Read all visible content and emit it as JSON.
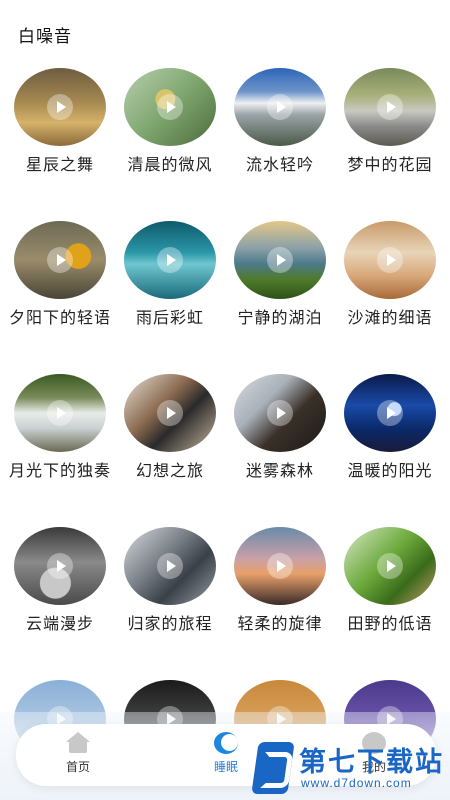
{
  "page": {
    "title": "白噪音"
  },
  "items": [
    {
      "label": "星辰之舞",
      "bg": "linear-gradient(180deg,#6d5c40 0%,#a88b52 45%,#d6b26a 70%,#8a6a3a 100%)"
    },
    {
      "label": "清晨的微风",
      "bg": "radial-gradient(circle at 45% 40%,#d9c46a 0 14%,transparent 15%),linear-gradient(135deg,#b8cfb0 0%,#7fa66e 50%,#4c6b3c 100%)"
    },
    {
      "label": "流水轻吟",
      "bg": "linear-gradient(180deg,#2f65b8 0%,#6c93c8 30%,#eef0f2 45%,#9aa3a8 60%,#4a5a48 100%)"
    },
    {
      "label": "梦中的花园",
      "bg": "linear-gradient(180deg,#7a8a5a 0%,#a8b07a 35%,#c9c9c0 55%,#8a8a8a 75%,#5b5b50 100%)"
    },
    {
      "label": "夕阳下的轻语",
      "bg": "radial-gradient(circle at 70% 45%,#e0a21a 0 16%,transparent 17%),linear-gradient(180deg,#6d6a55 0%,#9a8c6a 50%,#4a4436 100%)"
    },
    {
      "label": "雨后彩虹",
      "bg": "linear-gradient(180deg,#0e5a6a 0%,#2a96a8 40%,#6fc6d0 55%,#1a6a7a 100%)"
    },
    {
      "label": "宁静的湖泊",
      "bg": "linear-gradient(180deg,#e2c88a 0%,#8aa0a8 35%,#4d7a8a 55%,#4f7a2a 75%,#2e5218 100%)"
    },
    {
      "label": "沙滩的细语",
      "bg": "linear-gradient(180deg,#c89a6a 0%,#e8d4b8 40%,#d8a87a 70%,#a86a3a 100%)"
    },
    {
      "label": "月光下的独奏",
      "bg": "linear-gradient(180deg,#3a5a22 0%,#7a8a5a 30%,#e8ece8 50%,#c8d0d0 70%,#6a6a52 100%)"
    },
    {
      "label": "幻想之旅",
      "bg": "linear-gradient(135deg,#e8e2d8 0%,#8a6a50 40%,#2a2a2a 60%,#c8b8a0 100%)"
    },
    {
      "label": "迷雾森林",
      "bg": "linear-gradient(135deg,#d8dce0 0%,#a8b0b8 35%,#3a3028 60%,#1a1a1a 100%)"
    },
    {
      "label": "温暖的阳光",
      "bg": "radial-gradient(circle at 55% 45%,#a8c8ff 0 10%,transparent 11%),linear-gradient(180deg,#0a1a4a 0%,#1a4aa8 40%,#0a2a6a 70%,#1a1a3a 100%)"
    },
    {
      "label": "云端漫步",
      "bg": "radial-gradient(circle at 45% 72%,#c8c8c8 0 20%,transparent 21%),linear-gradient(180deg,#3a3a3a 0%,#8a8a8a 45%,#4a4a4a 100%)"
    },
    {
      "label": "归家的旅程",
      "bg": "linear-gradient(135deg,#d8dce0 0%,#7a8088 40%,#3a4048 65%,#9aa0a8 100%)"
    },
    {
      "label": "轻柔的旋律",
      "bg": "linear-gradient(180deg,#6a8aa8 0%,#c8a0a8 40%,#e8a06a 60%,#3a2a2a 100%)"
    },
    {
      "label": "田野的低语",
      "bg": "linear-gradient(135deg,#d8e8c8 0%,#6aa83a 45%,#3a6a1a 70%,#c8a06a 100%)"
    },
    {
      "label": "",
      "bg": "linear-gradient(180deg,#8ab0d8 0%,#c8d8e8 100%)"
    },
    {
      "label": "",
      "bg": "linear-gradient(180deg,#1a1a1a 0%,#6a6a6a 100%)"
    },
    {
      "label": "",
      "bg": "linear-gradient(180deg,#c8883a 0%,#e8b87a 100%)"
    },
    {
      "label": "",
      "bg": "linear-gradient(180deg,#4a3a8a 0%,#8a6ac8 100%)"
    }
  ],
  "tabs": [
    {
      "label": "首页",
      "icon": "home-icon",
      "active": false
    },
    {
      "label": "睡眠",
      "icon": "moon-icon",
      "active": true
    },
    {
      "label": "我的",
      "icon": "user-icon",
      "active": false
    }
  ],
  "watermark": {
    "title": "第七下载站",
    "url": "www.d7down.com"
  },
  "colors": {
    "accent": "#1d86e0",
    "tab_active_text": "#2a7fd4",
    "watermark": "#1a66c4"
  }
}
